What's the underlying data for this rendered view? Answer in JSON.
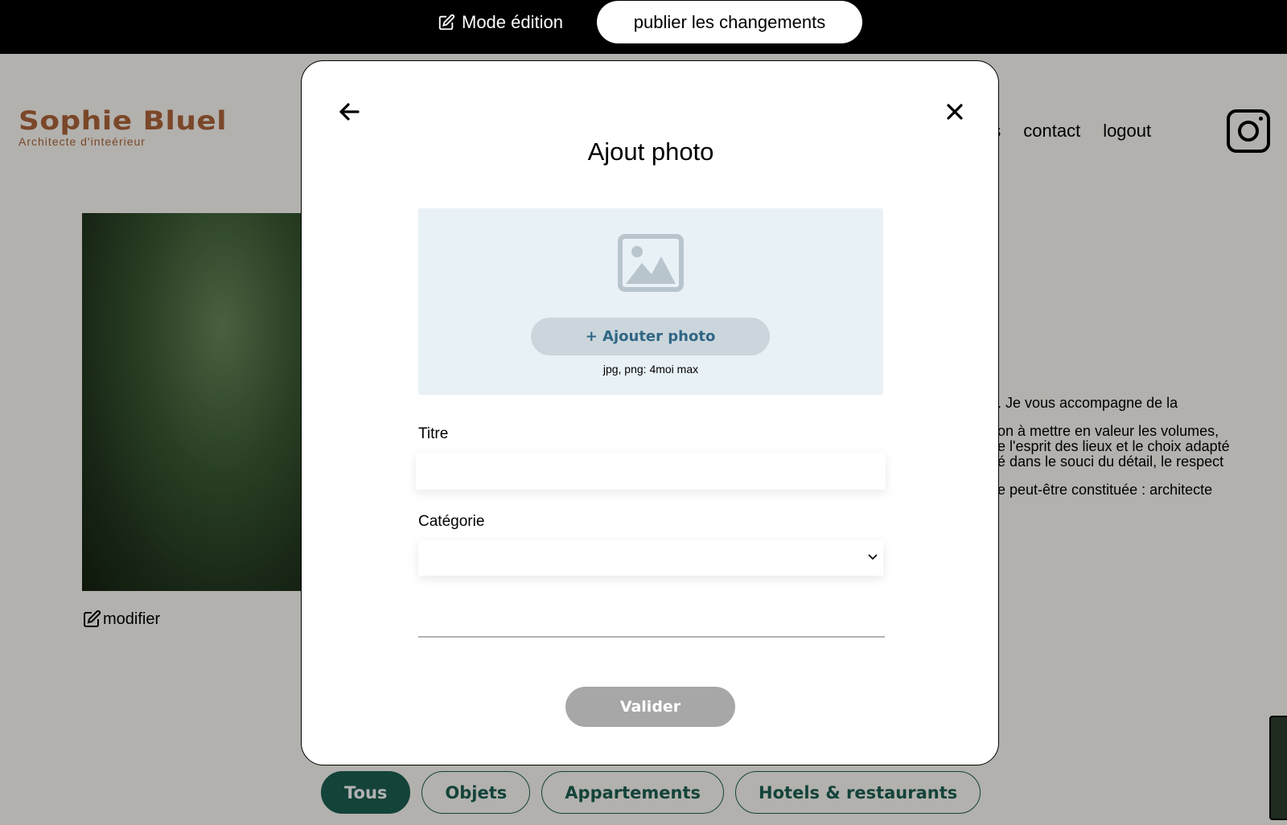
{
  "edit_bar": {
    "mode_label": "Mode édition",
    "publish_label": "publier les changements"
  },
  "header": {
    "logo_title": "Sophie Bluel",
    "logo_subtitle": "Architecte d'inteérieur",
    "nav": [
      "jets",
      "contact",
      "logout"
    ],
    "instagram_icon": "instagram-icon"
  },
  "intro": {
    "modify_label": "modifier",
    "lines": [
      ". Je vous accompagne de la",
      "on à mettre en valeur les volumes,\ne l'esprit des lieux et le choix adapté\né dans le souci du détail, le respect",
      "e peut-être constituée : architecte"
    ]
  },
  "filters": [
    {
      "label": "Tous",
      "active": true
    },
    {
      "label": "Objets",
      "active": false
    },
    {
      "label": "Appartements",
      "active": false
    },
    {
      "label": "Hotels & restaurants",
      "active": false
    }
  ],
  "modal": {
    "title": "Ajout photo",
    "back_icon": "arrow-left-icon",
    "close_icon": "close-icon",
    "upload": {
      "icon": "image-icon",
      "button_label": "+ Ajouter photo",
      "hint": "jpg, png: 4moi max"
    },
    "title_field": {
      "label": "Titre",
      "value": ""
    },
    "category_field": {
      "label": "Catégorie",
      "value": ""
    },
    "submit_label": "Valider"
  },
  "colors": {
    "brand": "#b1663c",
    "accent": "#1d6154",
    "upload_bg": "#e8f1f6",
    "upload_text": "#306685",
    "disabled_button": "#a7a7a7"
  }
}
